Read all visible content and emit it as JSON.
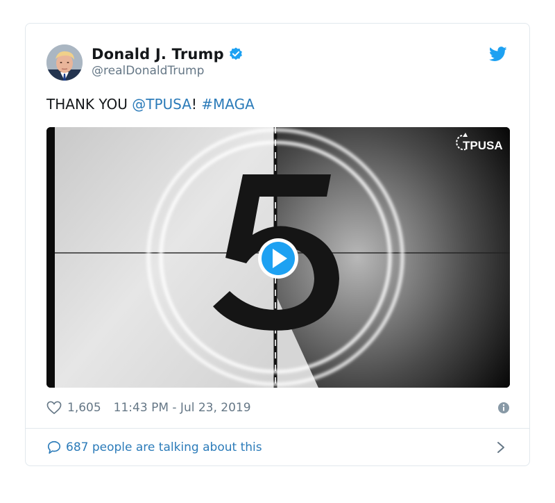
{
  "tweet": {
    "author_name": "Donald J. Trump",
    "handle": "@realDonaldTrump",
    "text_prefix": "THANK YOU ",
    "mention": "@TPUSA",
    "text_middle": "! ",
    "hashtag": "#MAGA",
    "likes": "1,605",
    "timestamp": "11:43 PM - Jul 23, 2019",
    "talking": "687 people are talking about this"
  },
  "media": {
    "watermark": "TPUSA",
    "countdown_digit": "5"
  },
  "icons": {
    "verified": "verified-badge-icon",
    "bird": "twitter-bird-icon",
    "heart": "heart-icon",
    "info": "info-icon",
    "comment": "comment-bubble-icon",
    "chevron": "chevron-right-icon",
    "play": "play-icon"
  },
  "colors": {
    "accent": "#1da1f2",
    "link": "#2b7bb9",
    "text": "#14171a",
    "muted": "#657786",
    "border": "#e1e8ed"
  }
}
